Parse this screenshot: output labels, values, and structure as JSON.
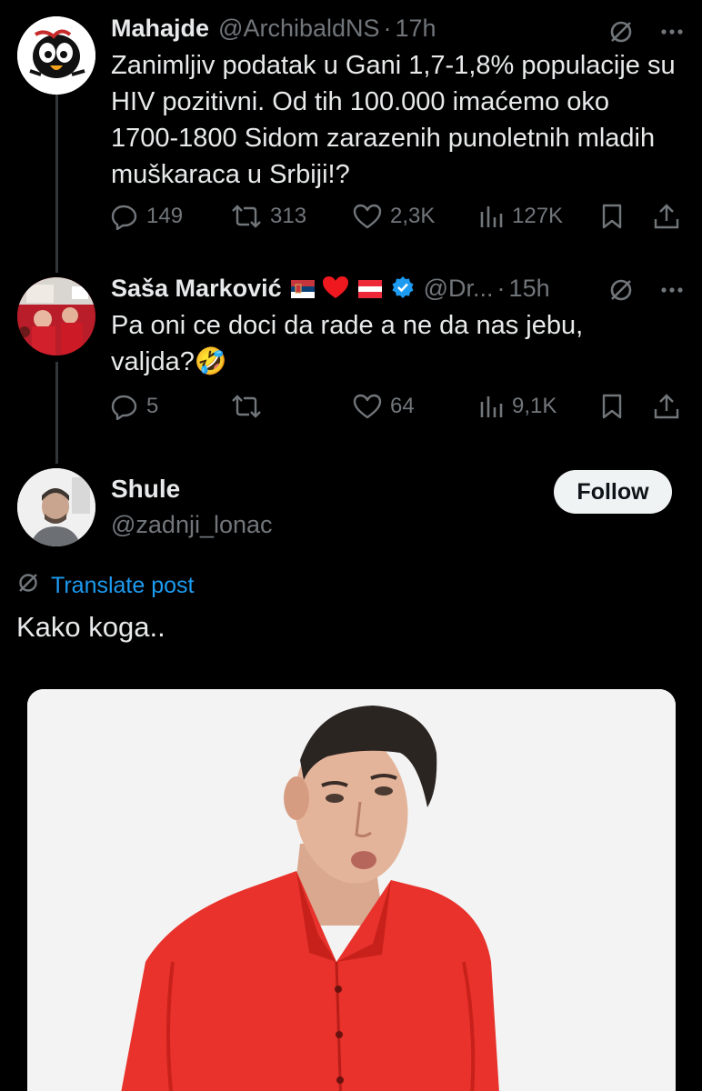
{
  "tweets": [
    {
      "name": "Mahajde",
      "handle": "@ArchibaldNS",
      "separator": "·",
      "time": "17h",
      "text": "Zanimljiv podatak u Gani 1,7-1,8% populacije su\nHIV pozitivni. Od tih 100.000 imaćemo oko\n1700-1800 Sidom zarazenih punoletnih mladih\nmuškaraca u Srbiji!?",
      "replies": "149",
      "reposts": "313",
      "likes": "2,3K",
      "views": "127K"
    },
    {
      "name": "Saša Marković",
      "handle": "@Dr...",
      "separator": "·",
      "time": "15h",
      "text": "Pa oni ce doci da rade a ne da nas jebu,\nvaljda?🤣",
      "replies": "5",
      "reposts": "",
      "likes": "64",
      "views": "9,1K",
      "verified": true
    }
  ],
  "main_post": {
    "name": "Shule",
    "handle": "@zadnji_lonac",
    "follow_label": "Follow",
    "translate_label": "Translate post",
    "text": "Kako koga.."
  },
  "colors": {
    "background": "#000000",
    "text": "#e7e9ea",
    "muted": "#71767b",
    "accent": "#1d9bf0",
    "shirt": "#e8322b"
  },
  "icons": [
    "grok-icon",
    "more-icon",
    "reply-icon",
    "repost-icon",
    "like-icon",
    "views-icon",
    "bookmark-icon",
    "share-icon",
    "verified-icon",
    "translate-icon"
  ]
}
